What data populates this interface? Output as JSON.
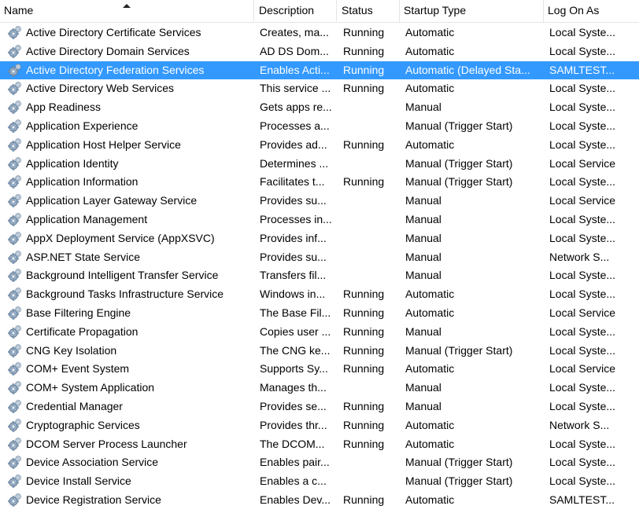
{
  "columns": {
    "name": "Name",
    "description": "Description",
    "status": "Status",
    "startup": "Startup Type",
    "logon": "Log On As"
  },
  "icon": "gear-service-icon",
  "selected_color": "#3399ff",
  "rows": [
    {
      "name": "Active Directory Certificate Services",
      "description": "Creates, ma...",
      "status": "Running",
      "startup": "Automatic",
      "logon": "Local Syste..."
    },
    {
      "name": "Active Directory Domain Services",
      "description": "AD DS Dom...",
      "status": "Running",
      "startup": "Automatic",
      "logon": "Local Syste..."
    },
    {
      "name": "Active Directory Federation Services",
      "description": "Enables Acti...",
      "status": "Running",
      "startup": "Automatic (Delayed Sta...",
      "logon": "SAMLTEST...",
      "selected": true
    },
    {
      "name": "Active Directory Web Services",
      "description": "This service ...",
      "status": "Running",
      "startup": "Automatic",
      "logon": "Local Syste..."
    },
    {
      "name": "App Readiness",
      "description": "Gets apps re...",
      "status": "",
      "startup": "Manual",
      "logon": "Local Syste..."
    },
    {
      "name": "Application Experience",
      "description": "Processes a...",
      "status": "",
      "startup": "Manual (Trigger Start)",
      "logon": "Local Syste..."
    },
    {
      "name": "Application Host Helper Service",
      "description": "Provides ad...",
      "status": "Running",
      "startup": "Automatic",
      "logon": "Local Syste..."
    },
    {
      "name": "Application Identity",
      "description": "Determines ...",
      "status": "",
      "startup": "Manual (Trigger Start)",
      "logon": "Local Service"
    },
    {
      "name": "Application Information",
      "description": "Facilitates t...",
      "status": "Running",
      "startup": "Manual (Trigger Start)",
      "logon": "Local Syste..."
    },
    {
      "name": "Application Layer Gateway Service",
      "description": "Provides su...",
      "status": "",
      "startup": "Manual",
      "logon": "Local Service"
    },
    {
      "name": "Application Management",
      "description": "Processes in...",
      "status": "",
      "startup": "Manual",
      "logon": "Local Syste..."
    },
    {
      "name": "AppX Deployment Service (AppXSVC)",
      "description": "Provides inf...",
      "status": "",
      "startup": "Manual",
      "logon": "Local Syste..."
    },
    {
      "name": "ASP.NET State Service",
      "description": "Provides su...",
      "status": "",
      "startup": "Manual",
      "logon": "Network S..."
    },
    {
      "name": "Background Intelligent Transfer Service",
      "description": "Transfers fil...",
      "status": "",
      "startup": "Manual",
      "logon": "Local Syste..."
    },
    {
      "name": "Background Tasks Infrastructure Service",
      "description": "Windows in...",
      "status": "Running",
      "startup": "Automatic",
      "logon": "Local Syste..."
    },
    {
      "name": "Base Filtering Engine",
      "description": "The Base Fil...",
      "status": "Running",
      "startup": "Automatic",
      "logon": "Local Service"
    },
    {
      "name": "Certificate Propagation",
      "description": "Copies user ...",
      "status": "Running",
      "startup": "Manual",
      "logon": "Local Syste..."
    },
    {
      "name": "CNG Key Isolation",
      "description": "The CNG ke...",
      "status": "Running",
      "startup": "Manual (Trigger Start)",
      "logon": "Local Syste..."
    },
    {
      "name": "COM+ Event System",
      "description": "Supports Sy...",
      "status": "Running",
      "startup": "Automatic",
      "logon": "Local Service"
    },
    {
      "name": "COM+ System Application",
      "description": "Manages th...",
      "status": "",
      "startup": "Manual",
      "logon": "Local Syste..."
    },
    {
      "name": "Credential Manager",
      "description": "Provides se...",
      "status": "Running",
      "startup": "Manual",
      "logon": "Local Syste..."
    },
    {
      "name": "Cryptographic Services",
      "description": "Provides thr...",
      "status": "Running",
      "startup": "Automatic",
      "logon": "Network S..."
    },
    {
      "name": "DCOM Server Process Launcher",
      "description": "The DCOM...",
      "status": "Running",
      "startup": "Automatic",
      "logon": "Local Syste..."
    },
    {
      "name": "Device Association Service",
      "description": "Enables pair...",
      "status": "",
      "startup": "Manual (Trigger Start)",
      "logon": "Local Syste..."
    },
    {
      "name": "Device Install Service",
      "description": "Enables a c...",
      "status": "",
      "startup": "Manual (Trigger Start)",
      "logon": "Local Syste..."
    },
    {
      "name": "Device Registration Service",
      "description": "Enables Dev...",
      "status": "Running",
      "startup": "Automatic",
      "logon": "SAMLTEST..."
    }
  ]
}
